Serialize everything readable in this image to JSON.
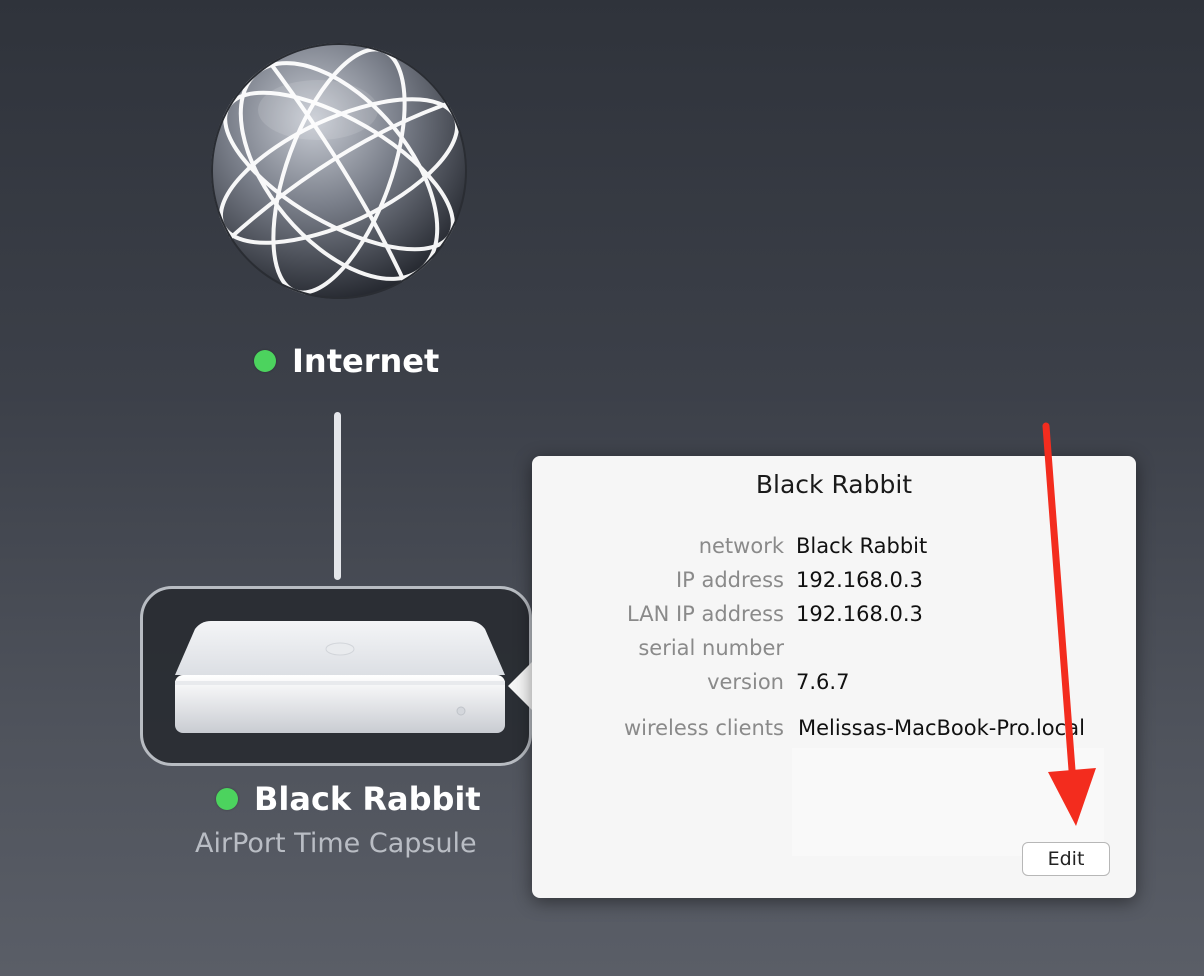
{
  "colors": {
    "status_online": "#4cd35e",
    "annotation_arrow": "#f32c1e",
    "popover_bg": "#f6f6f6"
  },
  "internet": {
    "label": "Internet",
    "icon": "globe-icon",
    "status": "online"
  },
  "base_station": {
    "name": "Black Rabbit",
    "model": "AirPort Time Capsule",
    "icon": "airport-time-capsule-icon",
    "status": "online"
  },
  "popover": {
    "title": "Black Rabbit",
    "rows": [
      {
        "key": "network",
        "value": "Black Rabbit"
      },
      {
        "key": "IP address",
        "value": "192.168.0.3"
      },
      {
        "key": "LAN IP address",
        "value": "192.168.0.3"
      },
      {
        "key": "serial number",
        "value": ""
      },
      {
        "key": "version",
        "value": "7.6.7"
      },
      {
        "key": "wireless clients",
        "value": "Melissas-MacBook-Pro.local"
      }
    ],
    "edit_label": "Edit"
  },
  "annotation": {
    "icon": "red-arrow-icon"
  }
}
